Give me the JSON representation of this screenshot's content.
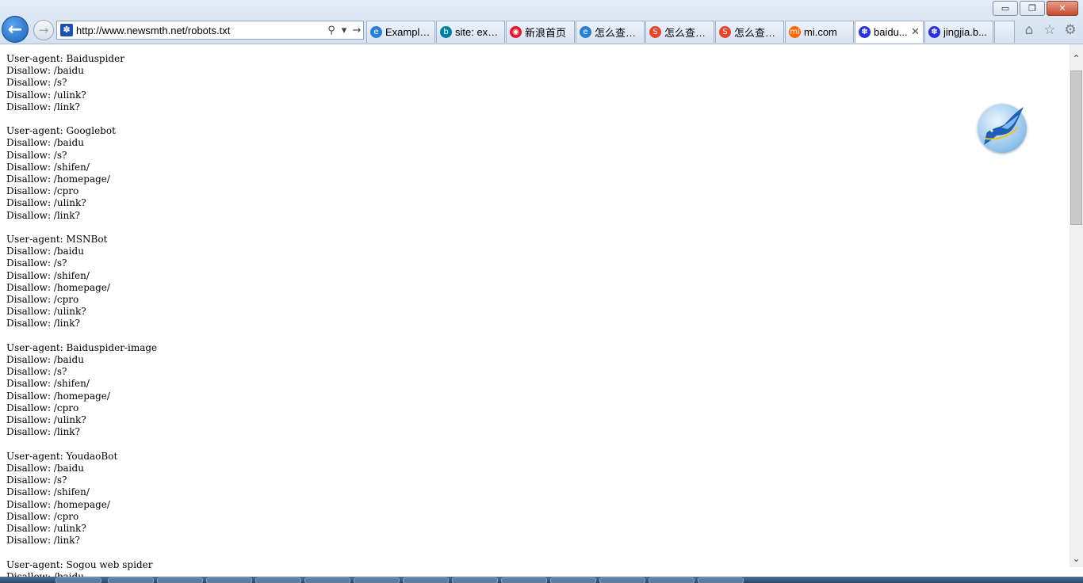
{
  "window": {
    "minimize_glyph": "▭",
    "restore_glyph": "❐",
    "close_glyph": "✕"
  },
  "nav": {
    "back_icon": "arrow-left-icon",
    "forward_icon": "arrow-right-icon",
    "back_glyph": "←",
    "forward_glyph": "→"
  },
  "address_bar": {
    "url": "http://www.newsmth.net/robots.txt",
    "search_glyph": "⚲",
    "dropdown_glyph": "▾",
    "go_glyph": "→"
  },
  "tabs": [
    {
      "label": "Example...",
      "icon": "ie-icon",
      "glyph": "e",
      "color": "#2a7fd4",
      "active": false
    },
    {
      "label": "site: exa...",
      "icon": "bing-icon",
      "glyph": "b",
      "color": "#00809d",
      "active": false
    },
    {
      "label": "新浪首页",
      "icon": "sina-weibo-icon",
      "glyph": "◉",
      "color": "#e6162d",
      "active": false
    },
    {
      "label": "怎么查看...",
      "icon": "ie-icon",
      "glyph": "e",
      "color": "#2a7fd4",
      "active": false
    },
    {
      "label": "怎么查看...",
      "icon": "sogou-icon",
      "glyph": "S",
      "color": "#e8452c",
      "active": false
    },
    {
      "label": "怎么查看...",
      "icon": "sogou-icon",
      "glyph": "S",
      "color": "#e8452c",
      "active": false
    },
    {
      "label": "mi.com",
      "icon": "mi-icon",
      "glyph": "mi",
      "color": "#ff6700",
      "active": false
    },
    {
      "label": "baidu...",
      "icon": "baidu-paw-icon",
      "glyph": "✽",
      "color": "#2932e1",
      "active": true
    },
    {
      "label": "jingjia.b...",
      "icon": "baidu-paw-icon",
      "glyph": "✽",
      "color": "#2932e1",
      "active": false
    }
  ],
  "tab_close_glyph": "✕",
  "toolbar": {
    "home_glyph": "⌂",
    "favorites_glyph": "☆",
    "settings_glyph": "⚙"
  },
  "robots_txt": "User-agent: Baiduspider\nDisallow: /baidu\nDisallow: /s?\nDisallow: /ulink?\nDisallow: /link?\n\nUser-agent: Googlebot\nDisallow: /baidu\nDisallow: /s?\nDisallow: /shifen/\nDisallow: /homepage/\nDisallow: /cpro\nDisallow: /ulink?\nDisallow: /link?\n\nUser-agent: MSNBot\nDisallow: /baidu\nDisallow: /s?\nDisallow: /shifen/\nDisallow: /homepage/\nDisallow: /cpro\nDisallow: /ulink?\nDisallow: /link?\n\nUser-agent: Baiduspider-image\nDisallow: /baidu\nDisallow: /s?\nDisallow: /shifen/\nDisallow: /homepage/\nDisallow: /cpro\nDisallow: /ulink?\nDisallow: /link?\n\nUser-agent: YoudaoBot\nDisallow: /baidu\nDisallow: /s?\nDisallow: /shifen/\nDisallow: /homepage/\nDisallow: /cpro\nDisallow: /ulink?\nDisallow: /link?\n\nUser-agent: Sogou web spider\nDisallow: /baidu",
  "scrollbar": {
    "up_glyph": "⌃",
    "down_glyph": "⌄"
  },
  "overlay_badge_icon": "bird-logo-icon"
}
